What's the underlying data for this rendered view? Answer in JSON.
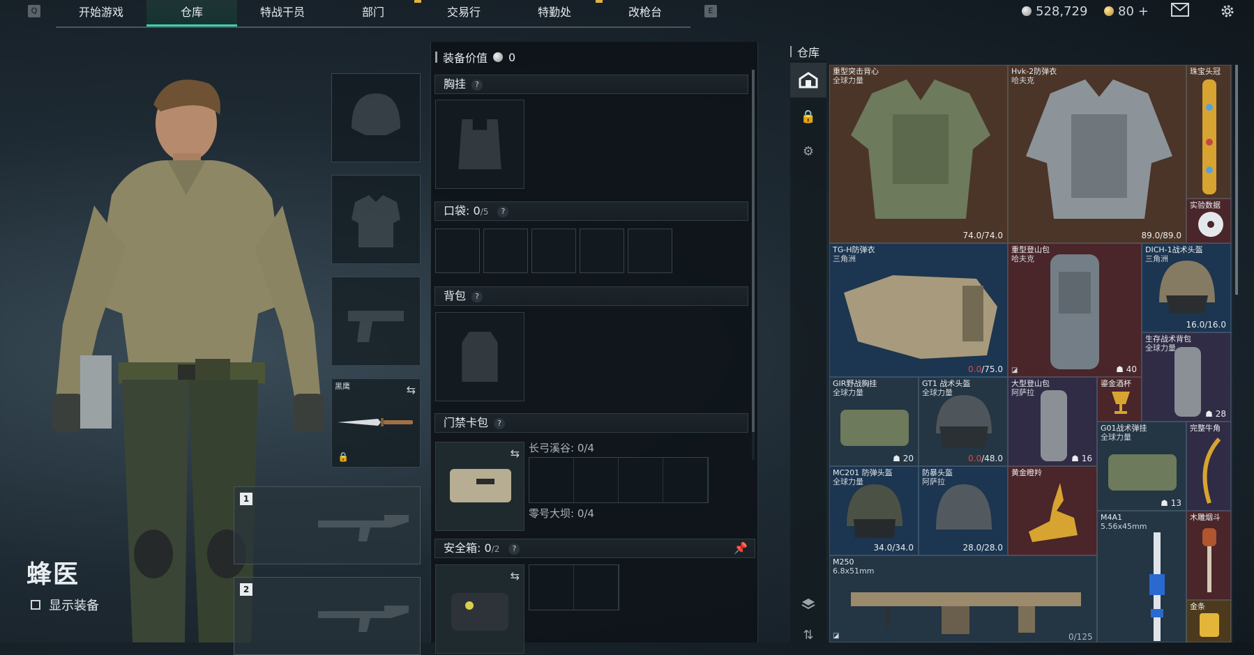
{
  "nav": {
    "left_key": "Q",
    "right_key": "E",
    "tabs": [
      {
        "label": "开始游戏",
        "notif": false
      },
      {
        "label": "仓库",
        "notif": false
      },
      {
        "label": "特战干员",
        "notif": false
      },
      {
        "label": "部门",
        "notif": true
      },
      {
        "label": "交易行",
        "notif": false
      },
      {
        "label": "特勤处",
        "notif": true
      },
      {
        "label": "改枪台",
        "notif": false
      }
    ],
    "active_tab": "仓库",
    "currency_silver": "528,729",
    "currency_gold": "80",
    "gold_plus": "+",
    "icons": [
      "mail-icon",
      "settings-gear-icon"
    ]
  },
  "character": {
    "operator_name": "蜂医",
    "show_equipment_label": "显示装备"
  },
  "equip_slots": {
    "melee_name": "黑鹰",
    "weapon_slot_1": "1",
    "weapon_slot_2": "2"
  },
  "loadout": {
    "value_label": "装备价值",
    "value": "0",
    "chest_rig": "胸挂",
    "pockets_label": "口袋:",
    "pockets_count": "0",
    "pockets_max": "/5",
    "backpack": "背包",
    "keycard_label": "门禁卡包",
    "keycard_lines": [
      {
        "label": "长弓溪谷: 0/4"
      },
      {
        "label": "零号大坝: 0/4"
      }
    ],
    "safebox_label": "安全箱:",
    "safebox_count": "0",
    "safebox_max": "/2",
    "help": "?"
  },
  "stash": {
    "title": "仓库",
    "capacity": "0/125",
    "items": [
      {
        "name": "重型突击背心",
        "sub": "全球力量",
        "dur_cur": "74.0",
        "dur_max": "/74.0"
      },
      {
        "name": "Hvk-2防弹衣",
        "sub": "哈夫克",
        "dur_cur": "89.0",
        "dur_max": "/89.0"
      },
      {
        "name": "珠宝头冠",
        "sub": ""
      },
      {
        "name": "实验数据",
        "sub": ""
      },
      {
        "name": "TG-H防弹衣",
        "sub": "三角洲",
        "dur_cur": "0.0",
        "dur_max": "/75.0"
      },
      {
        "name": "重型登山包",
        "sub": "哈夫克",
        "count": "40"
      },
      {
        "name": "DICH-1战术头盔",
        "sub": "三角洲",
        "dur_cur": "16.0",
        "dur_max": "/16.0"
      },
      {
        "name": "生存战术背包",
        "sub": "全球力量",
        "count": "28"
      },
      {
        "name": "GIR野战胸挂",
        "sub": "全球力量",
        "count": "20"
      },
      {
        "name": "GT1 战术头盔",
        "sub": "全球力量",
        "dur_cur": "0.0",
        "dur_max": "/48.0"
      },
      {
        "name": "大型登山包",
        "sub": "阿萨拉",
        "count": "16"
      },
      {
        "name": "鎏金酒杯",
        "sub": ""
      },
      {
        "name": "G01战术弹挂",
        "sub": "全球力量",
        "count": "13"
      },
      {
        "name": "完整牛角",
        "sub": ""
      },
      {
        "name": "MC201 防弹头盔",
        "sub": "全球力量",
        "dur_cur": "34.0",
        "dur_max": "/34.0"
      },
      {
        "name": "防暴头盔",
        "sub": "阿萨拉",
        "dur_cur": "28.0",
        "dur_max": "/28.0"
      },
      {
        "name": "黄金瞪羚",
        "sub": ""
      },
      {
        "name": "M4A1",
        "sub": "5.56x45mm"
      },
      {
        "name": "木雕烟斗",
        "sub": ""
      },
      {
        "name": "M250",
        "sub": "6.8x51mm"
      },
      {
        "name": "金条",
        "sub": ""
      }
    ]
  }
}
